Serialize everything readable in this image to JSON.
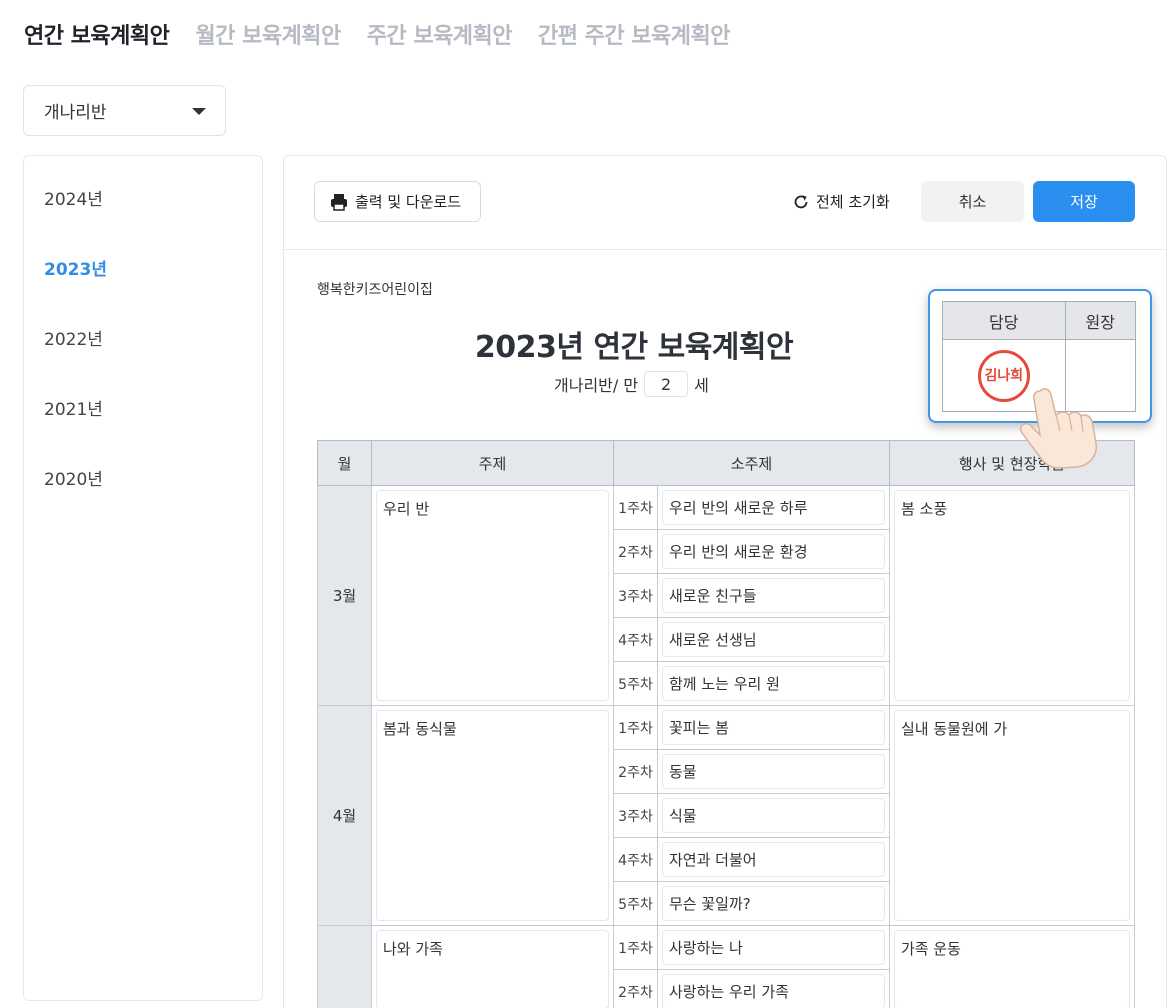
{
  "tabs": [
    "연간 보육계획안",
    "월간 보육계획안",
    "주간 보육계획안",
    "간편 주간 보육계획안"
  ],
  "class_select": {
    "value": "개나리반"
  },
  "years": [
    "2024년",
    "2023년",
    "2022년",
    "2021년",
    "2020년"
  ],
  "active_year": "2023년",
  "toolbar": {
    "print_label": "출력 및 다운로드",
    "reset_label": "전체 초기화",
    "cancel_label": "취소",
    "save_label": "저장"
  },
  "doc": {
    "center_name": "행복한키즈어린이집",
    "title": "2023년 연간 보육계획안",
    "class_prefix": "개나리반/ 만",
    "age": "2",
    "age_suffix": "세"
  },
  "approval": {
    "headers": [
      "담당",
      "원장"
    ],
    "stamp_text": "김나희"
  },
  "plan_headers": [
    "월",
    "주제",
    "소주제",
    "행사 및 현장학습"
  ],
  "months": [
    {
      "month": "3월",
      "theme": "우리 반",
      "event": "봄 소풍",
      "weeks": [
        {
          "label": "1주차",
          "topic": "우리 반의 새로운 하루"
        },
        {
          "label": "2주차",
          "topic": "우리 반의 새로운 환경"
        },
        {
          "label": "3주차",
          "topic": "새로운 친구들"
        },
        {
          "label": "4주차",
          "topic": "새로운 선생님"
        },
        {
          "label": "5주차",
          "topic": "함께 노는 우리 원"
        }
      ]
    },
    {
      "month": "4월",
      "theme": "봄과 동식물",
      "event": "실내 동물원에 가",
      "weeks": [
        {
          "label": "1주차",
          "topic": "꽃피는 봄"
        },
        {
          "label": "2주차",
          "topic": "동물"
        },
        {
          "label": "3주차",
          "topic": "식물"
        },
        {
          "label": "4주차",
          "topic": "자연과 더불어"
        },
        {
          "label": "5주차",
          "topic": "무슨 꽃일까?"
        }
      ]
    },
    {
      "month": "",
      "theme": "나와 가족",
      "event": "가족 운동",
      "weeks": [
        {
          "label": "1주차",
          "topic": "사랑하는 나"
        },
        {
          "label": "2주차",
          "topic": "사랑하는 우리 가족"
        }
      ]
    }
  ],
  "colors": {
    "accent": "#2b8ff0",
    "active_year": "#2f8fe6",
    "stamp": "#e44b3d"
  }
}
